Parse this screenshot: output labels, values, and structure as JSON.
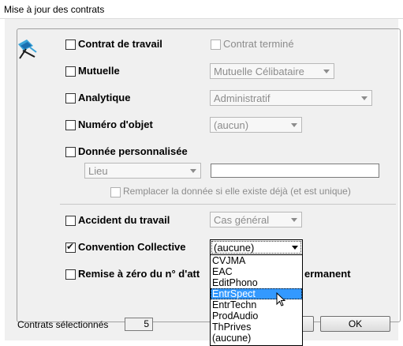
{
  "window": {
    "title": "Mise à jour des contrats"
  },
  "options": {
    "contrat_travail": {
      "label": "Contrat de travail",
      "checked": false
    },
    "contrat_termine": {
      "label": "Contrat terminé",
      "checked": false,
      "disabled": true
    },
    "mutuelle": {
      "label": "Mutuelle",
      "checked": false,
      "value": "Mutuelle Célibataire"
    },
    "analytique": {
      "label": "Analytique",
      "checked": false,
      "value": "Administratif"
    },
    "numero_objet": {
      "label": "Numéro d'objet",
      "checked": false,
      "value": "(aucun)"
    },
    "donnee_perso": {
      "label": "Donnée personnalisée",
      "checked": false,
      "field": "Lieu",
      "text": ""
    },
    "remplacer": {
      "label": "Remplacer la donnée si elle existe déjà (et est unique)",
      "checked": false,
      "disabled": true
    },
    "accident": {
      "label": "Accident du travail",
      "checked": false,
      "value": "Cas général"
    },
    "convention": {
      "label": "Convention Collective",
      "checked": true,
      "value": "(aucune)"
    },
    "remise_zero": {
      "label": "Remise à zéro du n° d'att",
      "label_tail": "ermanent",
      "checked": false
    }
  },
  "convention_dropdown": {
    "items": [
      "CVJMA",
      "EAC",
      "EditPhono",
      "EntrSpect",
      "EntrTechn",
      "ProdAudio",
      "ThPrives",
      "(aucune)"
    ],
    "highlighted": "EntrSpect"
  },
  "footer": {
    "selected_label": "Contrats sélectionnés",
    "selected_count": "5",
    "ok_label": "OK"
  },
  "icons": {
    "app_logo": "blue-chair-logo-icon",
    "cursor": "mouse-pointer-icon"
  }
}
